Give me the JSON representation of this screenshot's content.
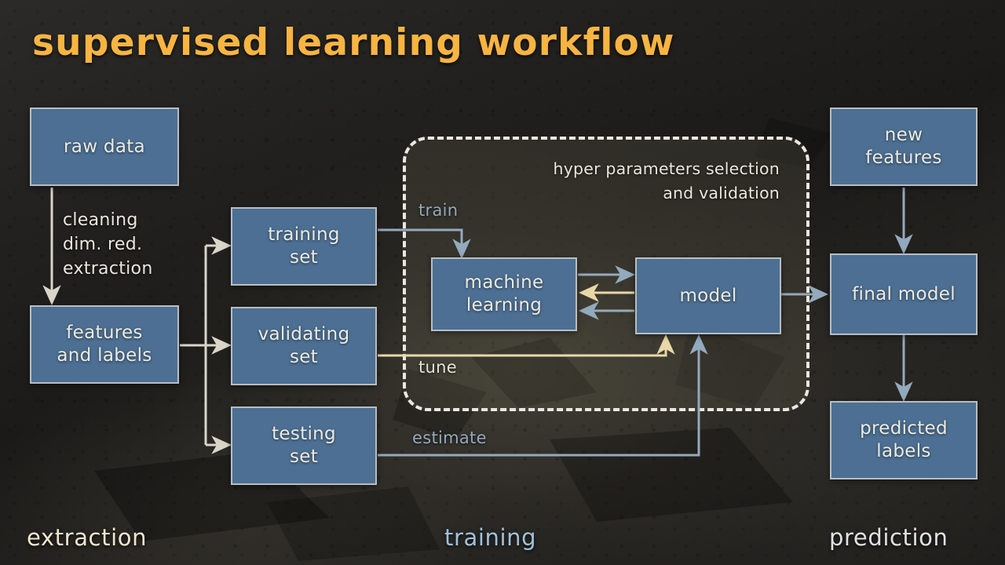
{
  "title": "supervised learning workflow",
  "colors": {
    "title": "#f7b441",
    "node_fill": "#4c6f93",
    "node_border": "#b9bdc1",
    "wire_light": "#d9d5c9",
    "wire_blue": "#93a9bd",
    "wire_warm": "#e8d8a8",
    "background": "#232220"
  },
  "training_panel": {
    "caption": "hyper parameters\nselection and validation"
  },
  "nodes": {
    "raw_data": "raw data",
    "features_and_labels": "features\nand labels",
    "training_set": "training\nset",
    "validating_set": "validating\nset",
    "testing_set": "testing\nset",
    "machine_learning": "machine\nlearning",
    "model": "model",
    "new_features": "new\nfeatures",
    "final_model": "final model",
    "predicted_labels": "predicted\nlabels"
  },
  "edge_labels": {
    "cleaning": "cleaning\ndim. red.\nextraction",
    "train": "train",
    "tune": "tune",
    "estimate": "estimate"
  },
  "stage_captions": {
    "extraction": "extraction",
    "training": "training",
    "prediction": "prediction"
  }
}
